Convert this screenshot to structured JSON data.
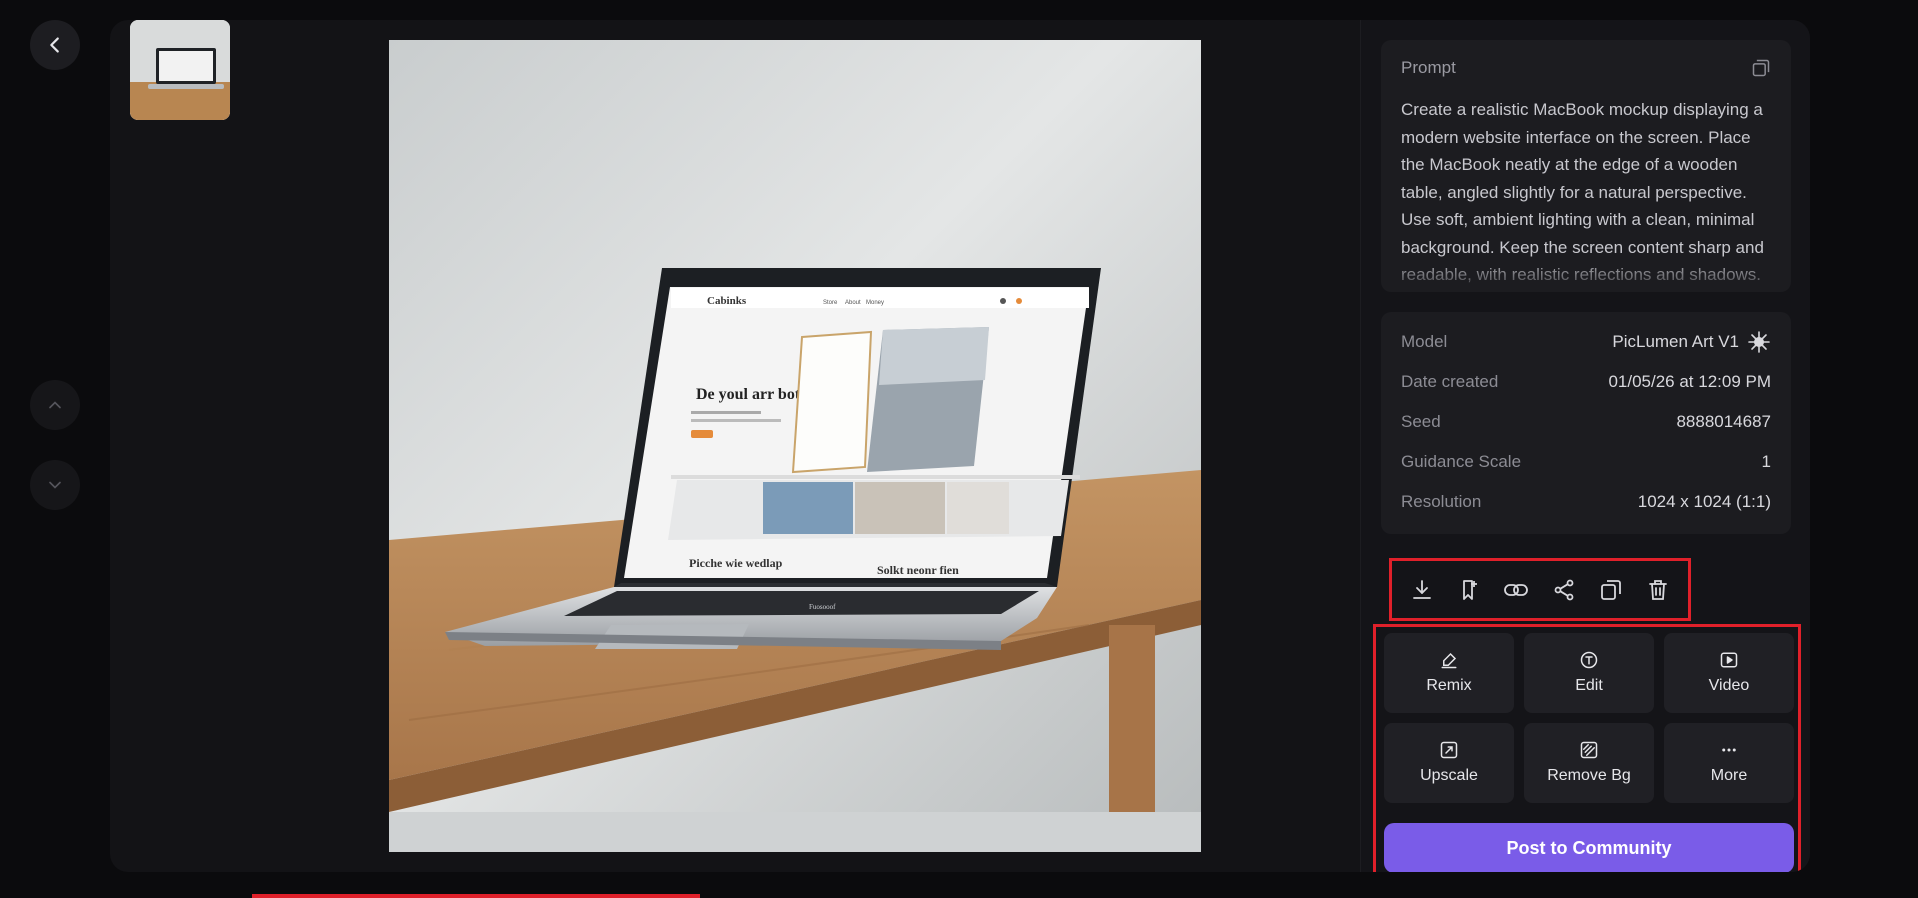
{
  "prompt": {
    "label": "Prompt",
    "text": "Create a realistic MacBook mockup displaying a modern website interface on the screen. Place the MacBook neatly at the edge of a wooden table, angled slightly for a natural perspective. Use soft, ambient lighting with a clean, minimal background. Keep the screen content sharp and readable, with realistic reflections and shadows."
  },
  "meta": {
    "rows": [
      {
        "label": "Model",
        "value": "PicLumen Art V1"
      },
      {
        "label": "Date created",
        "value": "01/05/26 at 12:09 PM"
      },
      {
        "label": "Seed",
        "value": "8888014687"
      },
      {
        "label": "Guidance Scale",
        "value": "1"
      },
      {
        "label": "Resolution",
        "value": "1024 x 1024 (1:1)"
      }
    ]
  },
  "toolbar": {
    "icons": [
      "download-icon",
      "bookmark-add-icon",
      "link-icon",
      "share-icon",
      "copy-icon",
      "trash-icon"
    ]
  },
  "actions": [
    {
      "label": "Remix",
      "icon": "brush-icon"
    },
    {
      "label": "Edit",
      "icon": "text-edit-icon"
    },
    {
      "label": "Video",
      "icon": "play-icon"
    },
    {
      "label": "Upscale",
      "icon": "upscale-icon"
    },
    {
      "label": "Remove Bg",
      "icon": "remove-bg-icon"
    },
    {
      "label": "More",
      "icon": "more-icon"
    }
  ],
  "post_label": "Post to Community",
  "image_screen": {
    "brand": "Cabinks",
    "nav": [
      "Store",
      "About",
      "Money"
    ],
    "headline": "De youl arr botky",
    "caption1": "Picche wie wedlap",
    "caption2": "Solkt neonr fien",
    "keyboard_brand": "Fuosooof"
  },
  "colors": {
    "accent": "#7a5ce8",
    "highlight": "#e0202a",
    "panel": "#1c1c20"
  }
}
